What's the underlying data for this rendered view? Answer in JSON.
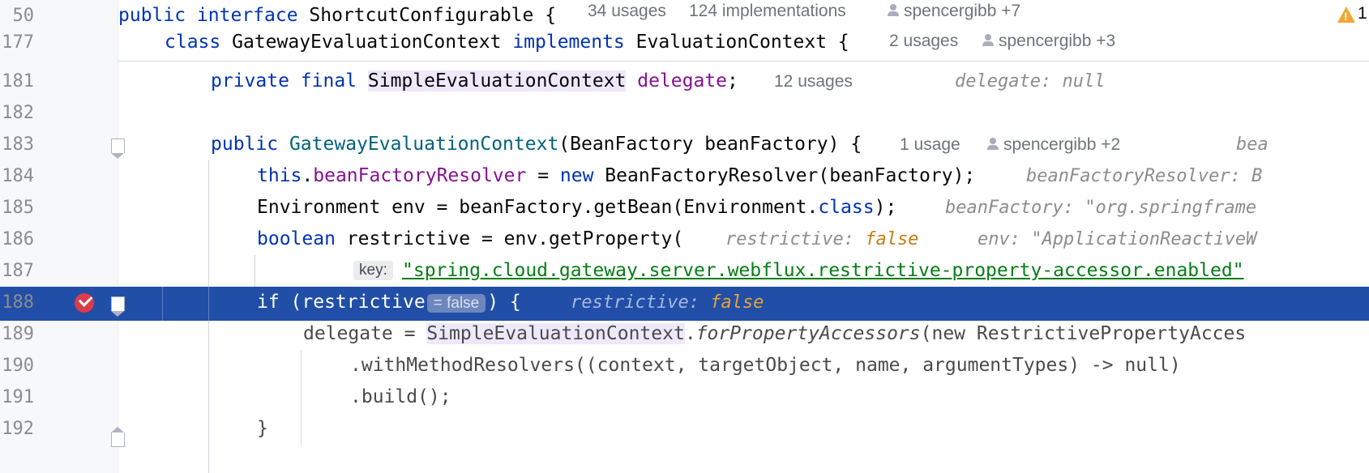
{
  "sticky": [
    {
      "line": "50",
      "keyword": "public interface",
      "name": "ShortcutConfigurable",
      "brace": " {",
      "usages": "34 usages",
      "impls": "124 implementations",
      "author": "spencergibb +7"
    },
    {
      "line": "177",
      "keyword": "class",
      "name": "GatewayEvaluationContext",
      "implements": "implements",
      "iface": "EvaluationContext",
      "brace": " {",
      "usages": "2 usages",
      "author": "spencergibb +3"
    }
  ],
  "warning": {
    "icon": "warning-icon",
    "count": "1",
    "color": "#f0a732"
  },
  "lines": {
    "l181": {
      "n": "181",
      "kw": "private final",
      "type": "SimpleEvaluationContext",
      "field": "delegate",
      "end": ";",
      "usages": "12 usages",
      "inline_label": "delegate:",
      "inline_value": "null"
    },
    "l182": {
      "n": "182"
    },
    "l183": {
      "n": "183",
      "kw": "public",
      "ctor": "GatewayEvaluationContext",
      "params": "(BeanFactory beanFactory) {",
      "usages": "1 usage",
      "author": "spencergibb +2",
      "inline_label": "bea"
    },
    "l184": {
      "n": "184",
      "this": "this",
      "dot": ".",
      "field": "beanFactoryResolver",
      "eq": " = ",
      "new": "new",
      "rest": " BeanFactoryResolver(beanFactory);",
      "inline_label": "beanFactoryResolver:",
      "inline_value": "B"
    },
    "l185": {
      "n": "185",
      "pre": "Environment env = beanFactory.getBean(Environment.",
      "cls": "class",
      "post": ");",
      "inline_label": "beanFactory:",
      "inline_value": "\"org.springframe"
    },
    "l186": {
      "n": "186",
      "kw": "boolean",
      "rest": " restrictive = env.getProperty(",
      "inline1_label": "restrictive:",
      "inline1_value": "false",
      "inline2_label": "env:",
      "inline2_value": "\"ApplicationReactiveW"
    },
    "l187": {
      "n": "187",
      "param": "key:",
      "str": "\"spring.cloud.gateway.server.webflux.restrictive-property-accessor.enabled\""
    },
    "l188": {
      "n": "188",
      "pre": "if (restrictive",
      "chip": "= false",
      "post": ") {",
      "inline_label": "restrictive:",
      "inline_value": "false"
    },
    "l189": {
      "n": "189",
      "pre": "delegate = ",
      "type": "SimpleEvaluationContext",
      "dot": ".",
      "method": "forPropertyAccessors",
      "rest": "(new RestrictivePropertyAcces"
    },
    "l190": {
      "n": "190",
      "code": ".withMethodResolvers((context, targetObject, name, argumentTypes) -> null)"
    },
    "l191": {
      "n": "191",
      "code": ".build();"
    },
    "l192": {
      "n": "192",
      "code": "}"
    }
  },
  "colors": {
    "keyword": "#0033b3",
    "field": "#871094",
    "method": "#00627a",
    "string": "#067d17",
    "selection": "#214fa8",
    "breakpoint": "#db3b4b",
    "inline_false": "#c77c0f"
  }
}
